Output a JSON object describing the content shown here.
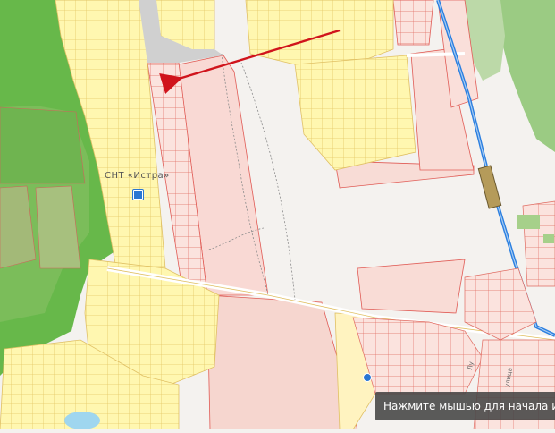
{
  "map": {
    "settlement_label": "СНТ «Истра»",
    "hint_text": "Нажмите мышью для начала изм",
    "street_label_1": "Лу",
    "street_label_2": "улица",
    "colors": {
      "forest": "#64b545",
      "meadow": "#a6c27a",
      "plot_fill": "#fff7b0",
      "plot_border": "#e7c96a",
      "parcel_fill": "#f9d9d4",
      "parcel_border": "#e05b55",
      "rail": "#2b7fe0",
      "arrow": "#d0141c"
    },
    "icons": [
      "info-marker-icon",
      "location-pin-icon",
      "red-arrow-icon"
    ]
  }
}
